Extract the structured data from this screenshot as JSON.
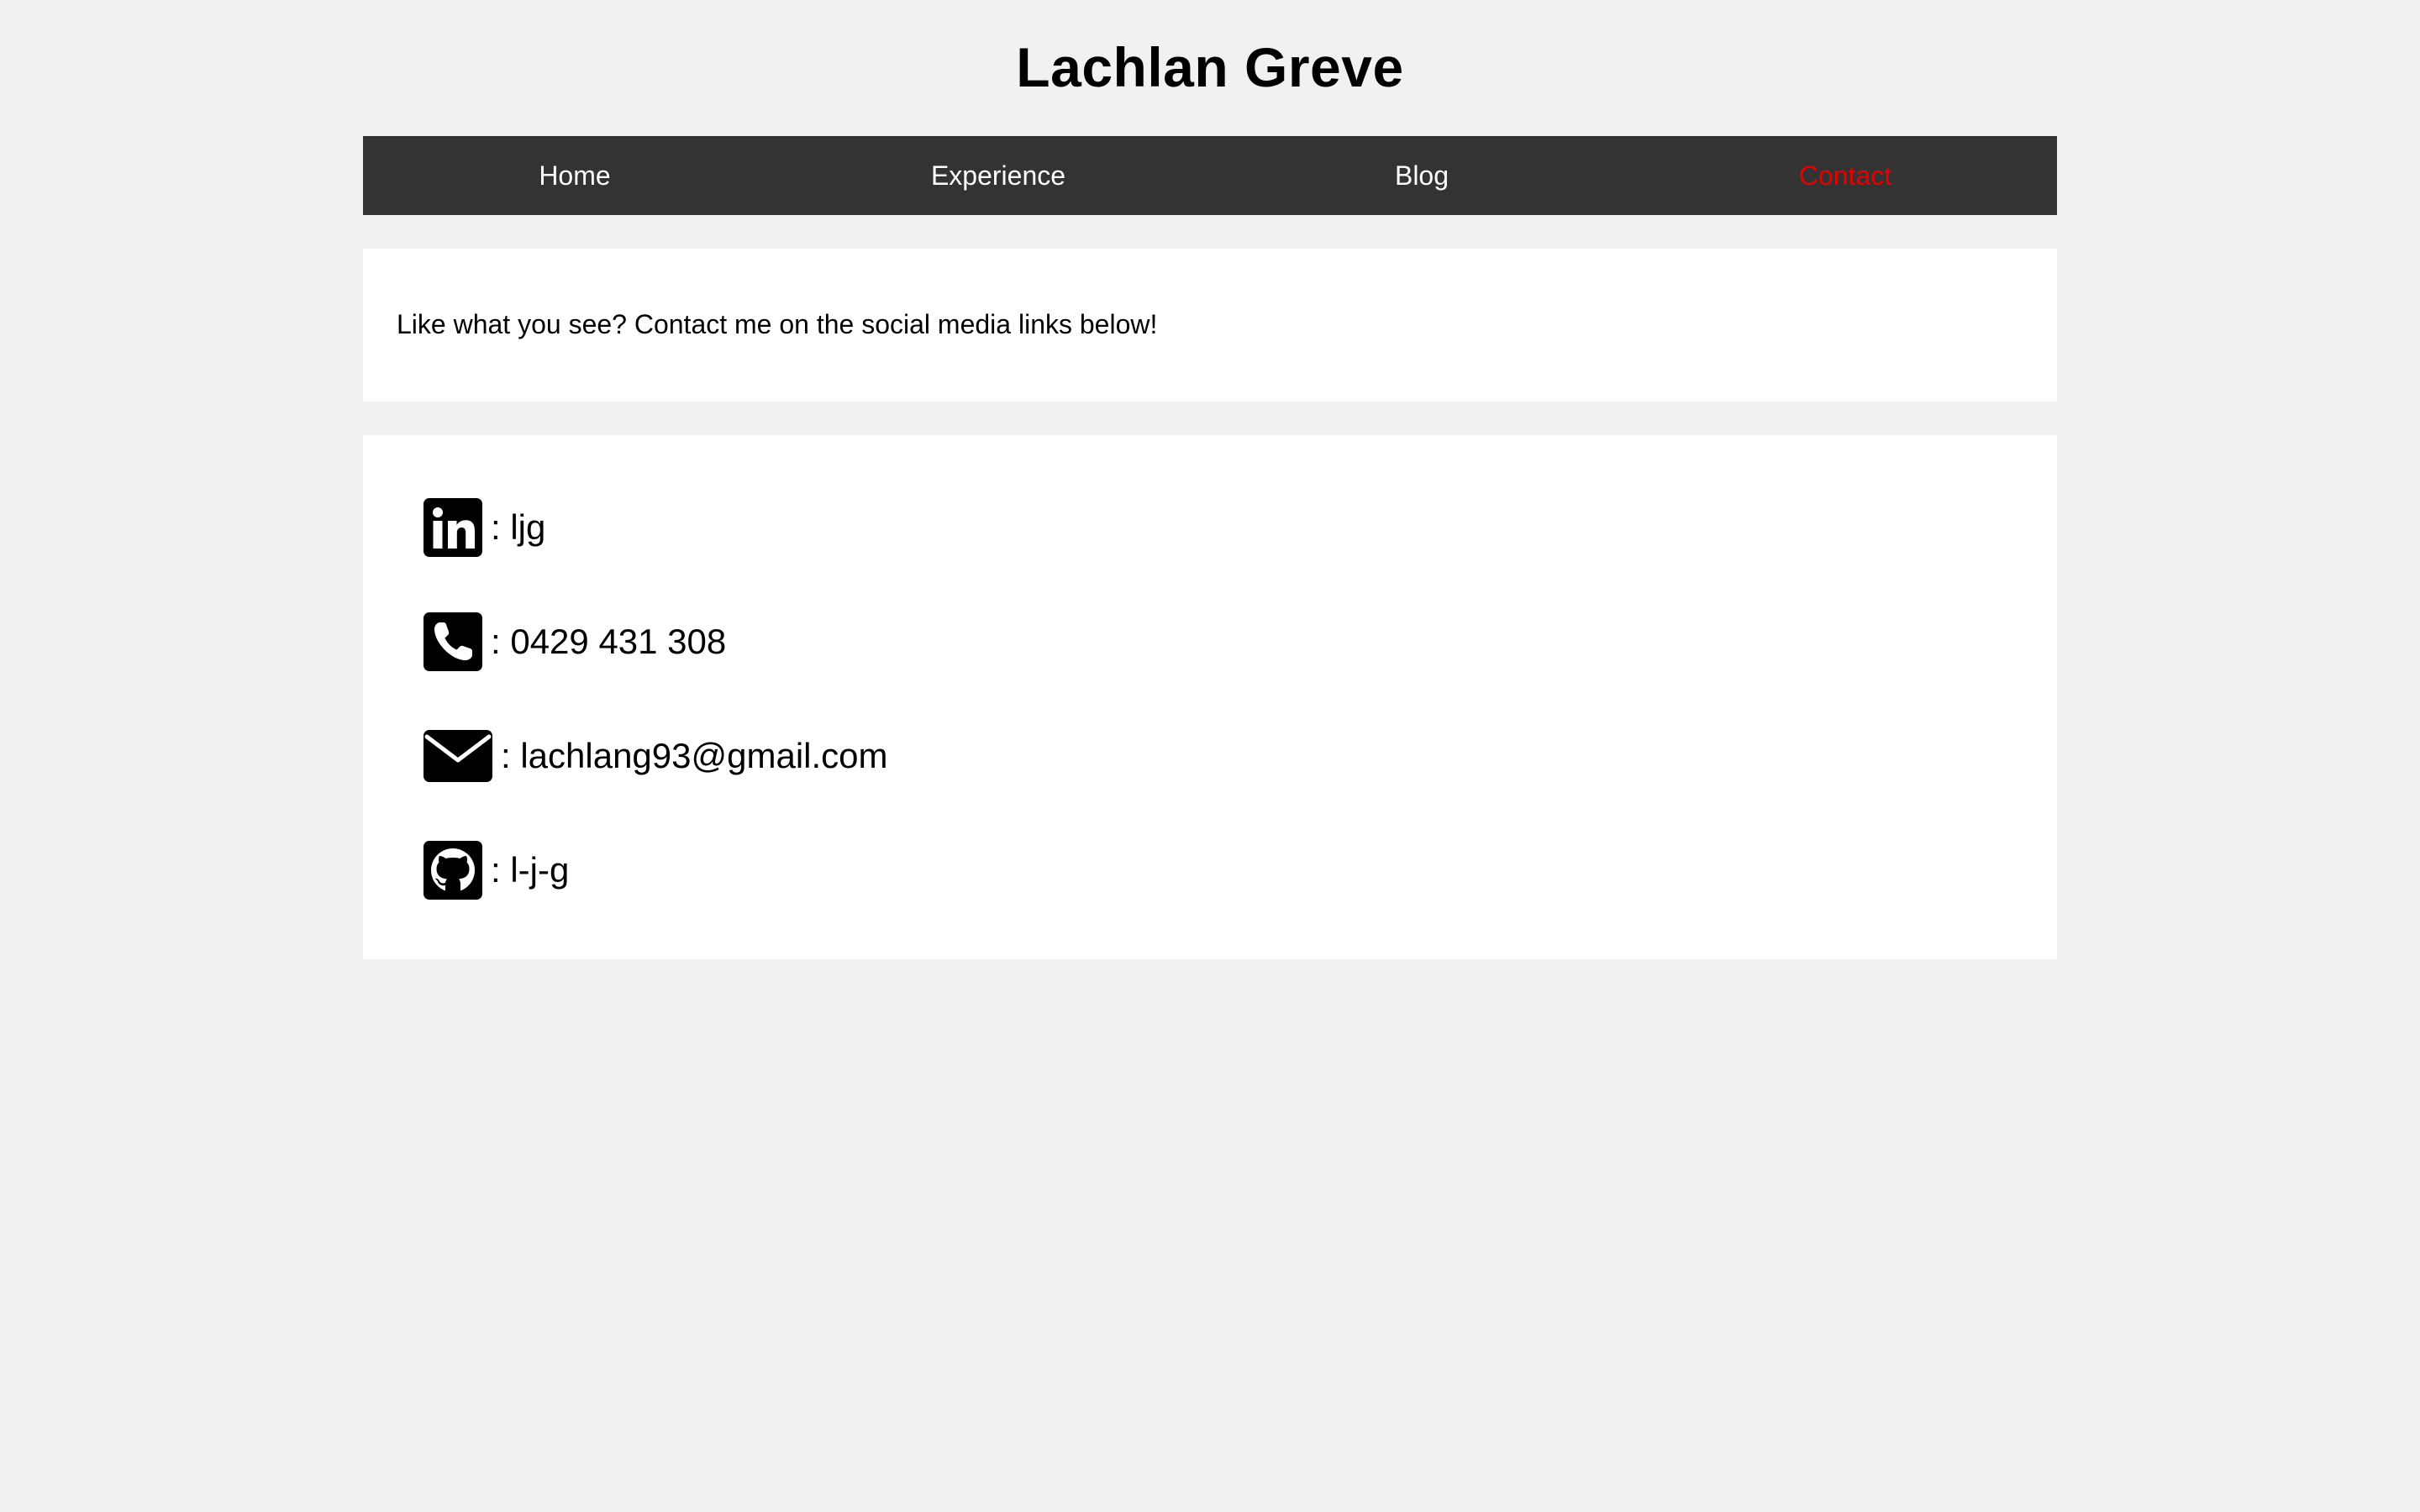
{
  "header": {
    "title": "Lachlan Greve"
  },
  "nav": {
    "items": [
      {
        "label": "Home",
        "active": false
      },
      {
        "label": "Experience",
        "active": false
      },
      {
        "label": "Blog",
        "active": false
      },
      {
        "label": "Contact",
        "active": true
      }
    ]
  },
  "intro": {
    "text": "Like what you see? Contact me on the social media links below!"
  },
  "contacts": {
    "linkedin": {
      "icon": "linkedin-icon",
      "value": ": ljg"
    },
    "phone": {
      "icon": "phone-icon",
      "value": ": 0429 431 308"
    },
    "email": {
      "icon": "email-icon",
      "value": ": lachlang93@gmail.com"
    },
    "github": {
      "icon": "github-icon",
      "value": ": l-j-g"
    }
  },
  "colors": {
    "page_background": "#f1f1f1",
    "nav_background": "#333333",
    "nav_text": "#ffffff",
    "nav_active": "#e60000",
    "card_background": "#ffffff"
  }
}
